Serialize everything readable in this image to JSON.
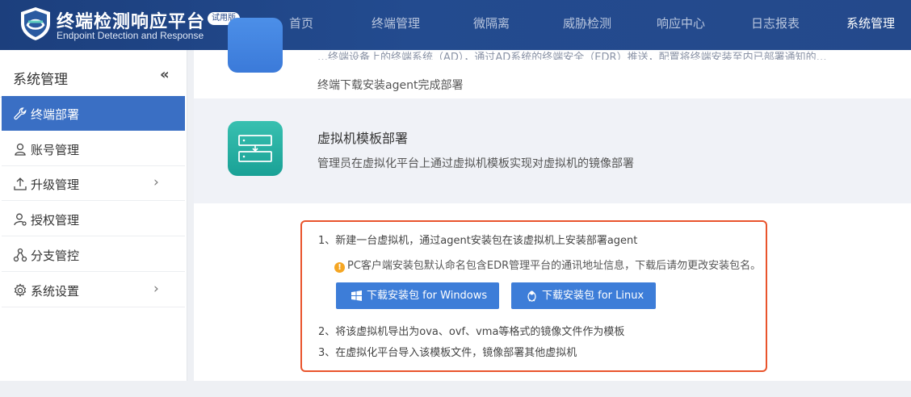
{
  "brand": {
    "title": "终端检测响应平台",
    "badge": "试用版",
    "subtitle": "Endpoint Detection and Response"
  },
  "nav": [
    {
      "label": "首页",
      "active": false
    },
    {
      "label": "终端管理",
      "active": false
    },
    {
      "label": "微隔离",
      "active": false
    },
    {
      "label": "威胁检测",
      "active": false
    },
    {
      "label": "响应中心",
      "active": false
    },
    {
      "label": "日志报表",
      "active": false
    },
    {
      "label": "系统管理",
      "active": true
    }
  ],
  "sidebar": {
    "title": "系统管理",
    "collapse_icon": "«",
    "items": [
      {
        "label": "终端部署",
        "icon": "wrench-icon",
        "active": true,
        "expandable": false
      },
      {
        "label": "账号管理",
        "icon": "user-icon",
        "active": false,
        "expandable": false
      },
      {
        "label": "升级管理",
        "icon": "upload-icon",
        "active": false,
        "expandable": true
      },
      {
        "label": "授权管理",
        "icon": "user-key-icon",
        "active": false,
        "expandable": false
      },
      {
        "label": "分支管控",
        "icon": "branch-icon",
        "active": false,
        "expandable": false
      },
      {
        "label": "系统设置",
        "icon": "gear-icon",
        "active": false,
        "expandable": true
      }
    ],
    "chevron": "›"
  },
  "main": {
    "top_card": {
      "desc_cut": "…终端设备上的终端系统（AD），通过AD系统的终端安全（EDR）推送，配置将终端安装至内已部署通知的…",
      "desc": "终端下载安装agent完成部署"
    },
    "vm_card": {
      "title": "虚拟机模板部署",
      "desc": "管理员在虚拟化平台上通过虚拟机模板实现对虚拟机的镜像部署"
    },
    "steps": {
      "step1": "1、新建一台虚拟机，通过agent安装包在该虚拟机上安装部署agent",
      "warning": "PC客户端安装包默认命名包含EDR管理平台的通讯地址信息，下载后请勿更改安装包名。",
      "warning_icon": "!",
      "btn_windows": "下载安装包 for Windows",
      "btn_linux": "下载安装包 for Linux",
      "step2": "2、将该虚拟机导出为ova、ovf、vma等格式的镜像文件作为模板",
      "step3": "3、在虚拟化平台导入该模板文件，镜像部署其他虚拟机"
    }
  },
  "colors": {
    "topbar": "#234b8f",
    "sidebar_active": "#3a6fc4",
    "button": "#3d7dd8",
    "highlight_border": "#e9542c",
    "warning": "#f5a623",
    "vm_icon": "#1aa196"
  }
}
